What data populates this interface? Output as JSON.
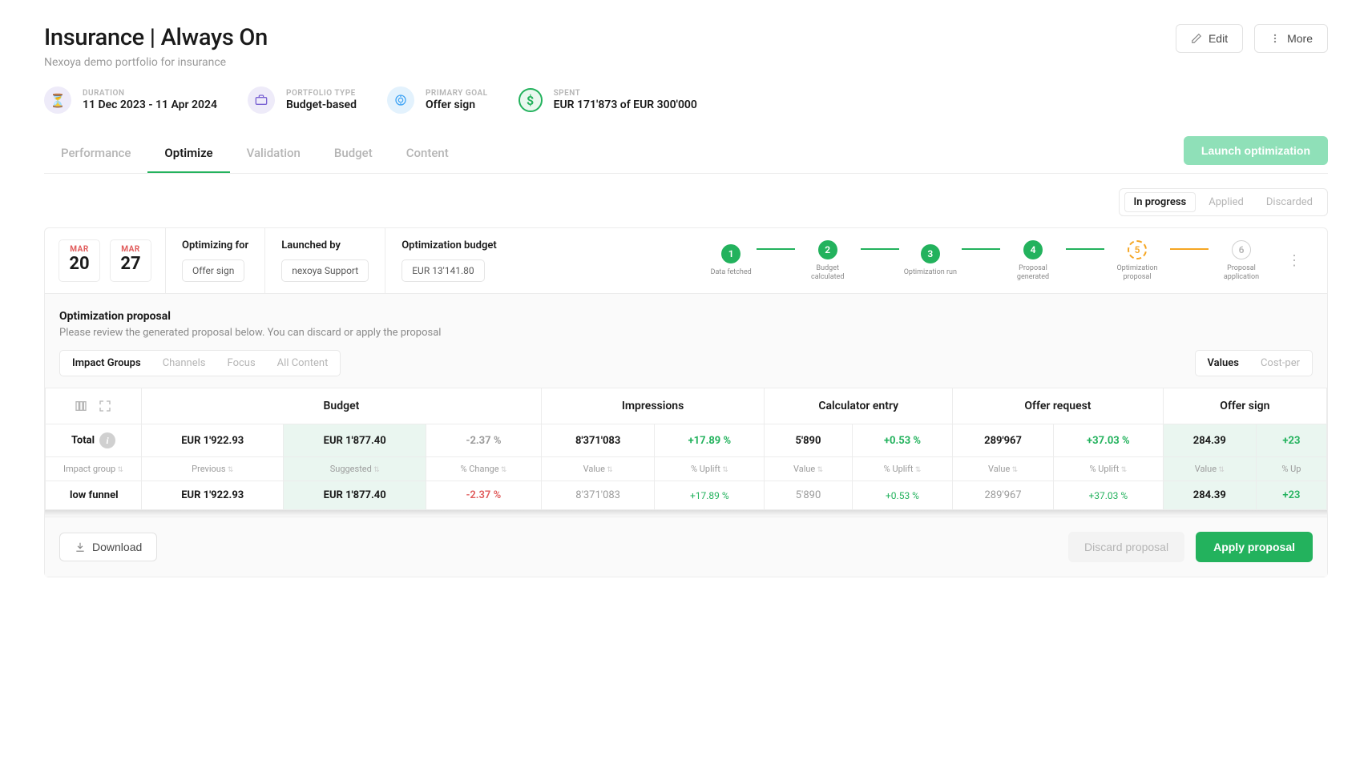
{
  "header": {
    "title": "Insurance | Always On",
    "subtitle": "Nexoya demo portfolio for insurance",
    "edit_label": "Edit",
    "more_label": "More"
  },
  "meta": {
    "duration_label": "DURATION",
    "duration_value": "11 Dec 2023 - 11 Apr 2024",
    "portfolio_label": "PORTFOLIO TYPE",
    "portfolio_value": "Budget-based",
    "goal_label": "PRIMARY GOAL",
    "goal_value": "Offer sign",
    "spent_label": "SPENT",
    "spent_value": "EUR 171'873 of EUR 300'000"
  },
  "tabs": {
    "performance": "Performance",
    "optimize": "Optimize",
    "validation": "Validation",
    "budget": "Budget",
    "content": "Content",
    "launch": "Launch optimization"
  },
  "status": {
    "in_progress": "In progress",
    "applied": "Applied",
    "discarded": "Discarded"
  },
  "dates": {
    "start_month": "MAR",
    "start_day": "20",
    "end_month": "MAR",
    "end_day": "27"
  },
  "info": {
    "optimizing_for_label": "Optimizing for",
    "optimizing_for_value": "Offer sign",
    "launched_by_label": "Launched by",
    "launched_by_value": "nexoya Support",
    "opt_budget_label": "Optimization budget",
    "opt_budget_value": "EUR 13'141.80"
  },
  "steps": [
    "Data fetched",
    "Budget calculated",
    "Optimization run",
    "Proposal generated",
    "Optimization proposal",
    "Proposal application"
  ],
  "proposal": {
    "title": "Optimization proposal",
    "desc": "Please review the generated proposal below. You can discard or apply the proposal"
  },
  "views": {
    "impact_groups": "Impact Groups",
    "channels": "Channels",
    "focus": "Focus",
    "all_content": "All Content",
    "values": "Values",
    "cost_per": "Cost-per"
  },
  "table": {
    "group_heads": [
      "Budget",
      "Impressions",
      "Calculator entry",
      "Offer request",
      "Offer sign"
    ],
    "total_label": "Total",
    "subheads": {
      "impact_group": "Impact group",
      "previous": "Previous",
      "suggested": "Suggested",
      "change": "% Change",
      "value": "Value",
      "uplift": "% Uplift",
      "up": "% Up"
    },
    "totals": {
      "previous": "EUR 1'922.93",
      "suggested": "EUR 1'877.40",
      "change": "-2.37 %",
      "imp_value": "8'371'083",
      "imp_uplift": "+17.89 %",
      "calc_value": "5'890",
      "calc_uplift": "+0.53 %",
      "req_value": "289'967",
      "req_uplift": "+37.03 %",
      "sign_value": "284.39",
      "sign_uplift": "+23"
    },
    "rows": [
      {
        "name": "low funnel",
        "previous": "EUR 1'922.93",
        "suggested": "EUR 1'877.40",
        "change": "-2.37 %",
        "imp_value": "8'371'083",
        "imp_uplift": "+17.89 %",
        "calc_value": "5'890",
        "calc_uplift": "+0.53 %",
        "req_value": "289'967",
        "req_uplift": "+37.03 %",
        "sign_value": "284.39",
        "sign_uplift": "+23"
      }
    ]
  },
  "footer": {
    "download": "Download",
    "discard": "Discard proposal",
    "apply": "Apply proposal"
  }
}
